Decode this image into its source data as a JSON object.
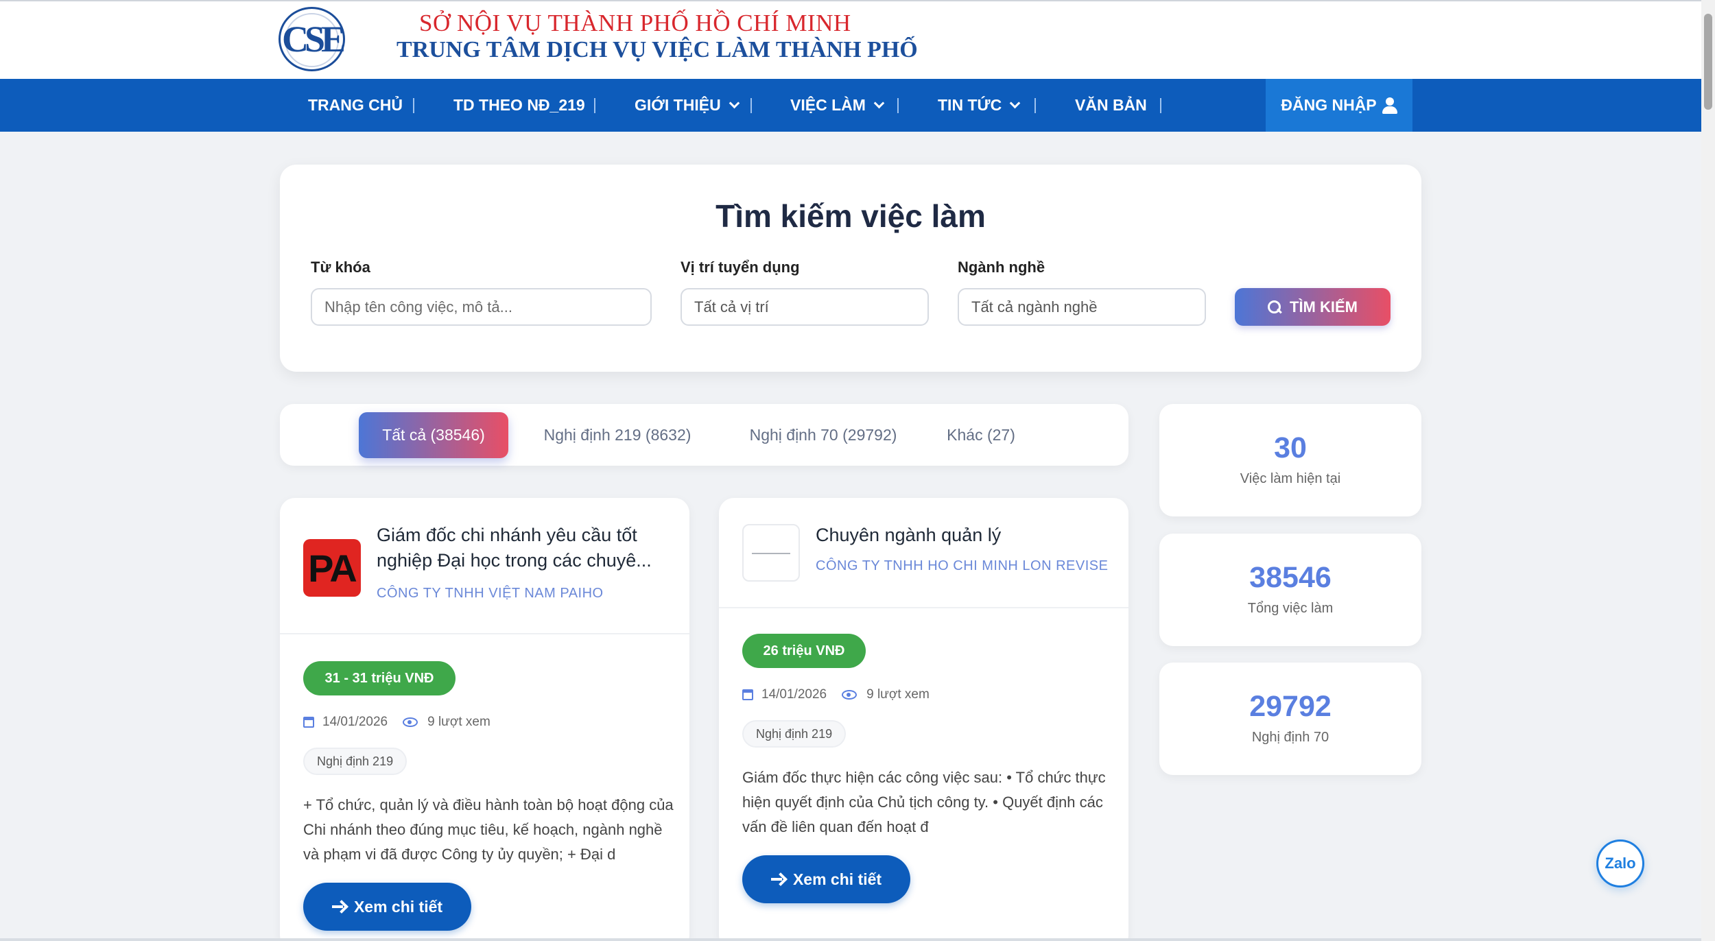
{
  "header": {
    "logo_text": "CSE",
    "brand_line1": "SỞ NỘI VỤ THÀNH PHỐ HỒ CHÍ MINH",
    "brand_line2": "TRUNG TÂM DỊCH VỤ VIỆC LÀM THÀNH PHỐ"
  },
  "nav": {
    "items": [
      {
        "label": "TRANG CHỦ",
        "has_dropdown": false
      },
      {
        "label": "TD THEO NĐ_219",
        "has_dropdown": false
      },
      {
        "label": "GIỚI THIỆU",
        "has_dropdown": true
      },
      {
        "label": "VIỆC LÀM",
        "has_dropdown": true
      },
      {
        "label": "TIN TỨC",
        "has_dropdown": true
      },
      {
        "label": "VĂN BẢN",
        "has_dropdown": false
      }
    ],
    "login_label": "ĐĂNG NHẬP",
    "bg_color": "#0d5cbb"
  },
  "search": {
    "title": "Tìm kiếm việc làm",
    "keyword_label": "Từ khóa",
    "keyword_placeholder": "Nhập tên công việc, mô tả...",
    "position_label": "Vị trí tuyển dụng",
    "position_value": "Tất cả vị trí",
    "industry_label": "Ngành nghề",
    "industry_value": "Tất cả ngành nghề",
    "button_label": "TÌM KIẾM"
  },
  "tabs": [
    {
      "label": "Tất cả (38546)",
      "active": true
    },
    {
      "label": "Nghị định 219 (8632)",
      "active": false
    },
    {
      "label": "Nghị định 70 (29792)",
      "active": false
    },
    {
      "label": "Khác (27)",
      "active": false
    }
  ],
  "stats": [
    {
      "value": "30",
      "label": "Việc làm hiện tại"
    },
    {
      "value": "38546",
      "label": "Tổng việc làm"
    },
    {
      "value": "29792",
      "label": "Nghị định 70"
    }
  ],
  "jobs": [
    {
      "logo_text": "PA",
      "title": "Giám đốc chi nhánh yêu cầu tốt nghiệp Đại học trong các chuyê...",
      "company": "CÔNG TY TNHH VIỆT NAM PAIHO",
      "salary": "31 - 31 triệu VNĐ",
      "date": "14/01/2026",
      "views": "9 lượt xem",
      "tag": "Nghị định 219",
      "description": "+ Tổ chức, quản lý và điều hành toàn bộ hoạt động của Chi nhánh theo đúng mục tiêu, kế hoạch, ngành nghề và phạm vi đã được Công ty ủy quyền; + Đại d",
      "button_label": "Xem chi tiết"
    },
    {
      "logo_text": "",
      "title": "Chuyên ngành quản lý",
      "company": "CÔNG TY TNHH HO CHI MINH LON REVISE",
      "salary": "26 triệu VNĐ",
      "date": "14/01/2026",
      "views": "9 lượt xem",
      "tag": "Nghị định 219",
      "description": "Giám đốc thực hiện các công việc sau: • Tổ chức thực hiện quyết định của Chủ tịch công ty. • Quyết định các vấn đề liên quan đến hoạt đ",
      "button_label": "Xem chi tiết"
    }
  ],
  "zalo_label": "Zalo"
}
